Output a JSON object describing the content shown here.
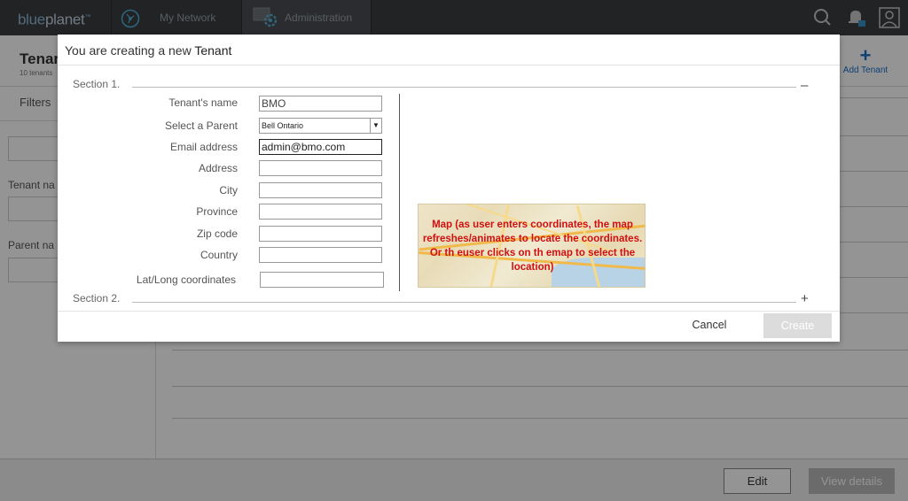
{
  "app": {
    "logo_part1": "blue",
    "logo_part2": "planet",
    "tabs": [
      {
        "label": "My Network",
        "icon": "network-icon"
      },
      {
        "label": "Administration",
        "icon": "admin-gear-icon"
      }
    ],
    "top_icons": [
      "search-icon",
      "notification-bell-icon",
      "user-profile-icon"
    ]
  },
  "background_page": {
    "title": "Tenar",
    "subtitle": "10 tenants",
    "add_label": "Add Tenant",
    "filters_label": "Filters",
    "filter_labels": [
      "Tenant na",
      "Parent na"
    ],
    "footer_buttons": {
      "edit": "Edit",
      "view_details": "View details"
    }
  },
  "modal": {
    "title_prefix": "You are creating a new ",
    "title_entity": "Tenant",
    "section1": {
      "label": "Section 1.",
      "toggle": "–"
    },
    "section2": {
      "label": "Section 2.",
      "toggle": "+"
    },
    "fields": {
      "tenant_name": {
        "label": "Tenant's name",
        "value": "BMO"
      },
      "parent": {
        "label": "Select a Parent",
        "value": "Bell Ontario"
      },
      "email": {
        "label": "Email address",
        "value": "admin@bmo.com"
      },
      "address": {
        "label": "Address",
        "value": ""
      },
      "city": {
        "label": "City",
        "value": ""
      },
      "province": {
        "label": "Province",
        "value": ""
      },
      "zip": {
        "label": "Zip code",
        "value": ""
      },
      "country": {
        "label": "Country",
        "value": ""
      },
      "latlong": {
        "label": "Lat/Long coordinates",
        "value": ""
      }
    },
    "map_note": "Map (as user enters coordinates, the map refreshes/animates to locate the coordinates. Or th euser clicks on th emap to select the location)",
    "buttons": {
      "cancel": "Cancel",
      "create": "Create"
    }
  }
}
